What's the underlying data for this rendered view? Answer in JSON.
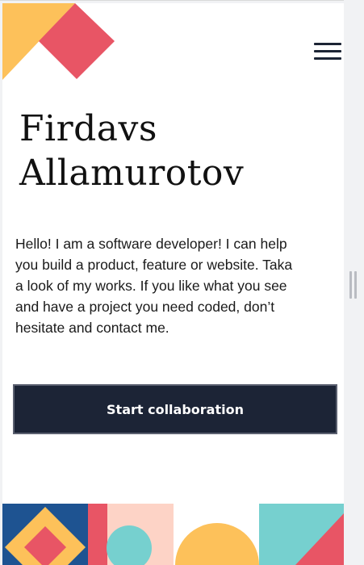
{
  "header": {
    "menu_icon": "hamburger-menu-icon"
  },
  "hero": {
    "title_first": "Firdavs",
    "title_last": "Allamurotov",
    "intro": "Hello! I am a software developer! I can help you build a product, feature or website. Taka a look of my works. If you like what you see and have a project you need coded, don’t hesitate and contact me.",
    "cta_label": "Start collaboration"
  },
  "colors": {
    "navy": "#1c2436",
    "yellow": "#fdc15a",
    "coral": "#e85565",
    "blue": "#1e5391",
    "peach": "#fdd3c6",
    "teal": "#76d0cf"
  }
}
